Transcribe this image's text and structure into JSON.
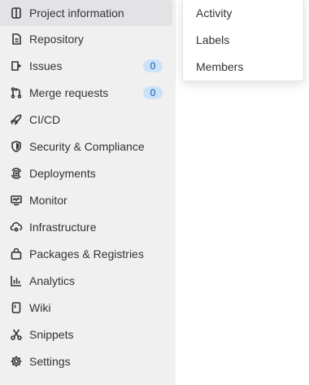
{
  "sidebar": {
    "items": [
      {
        "label": "Project information",
        "icon": "project-information-icon",
        "active": true
      },
      {
        "label": "Repository",
        "icon": "repository-icon"
      },
      {
        "label": "Issues",
        "icon": "issues-icon",
        "badge": "0"
      },
      {
        "label": "Merge requests",
        "icon": "merge-requests-icon",
        "badge": "0"
      },
      {
        "label": "CI/CD",
        "icon": "rocket-icon"
      },
      {
        "label": "Security & Compliance",
        "icon": "shield-icon"
      },
      {
        "label": "Deployments",
        "icon": "deployments-icon"
      },
      {
        "label": "Monitor",
        "icon": "monitor-icon"
      },
      {
        "label": "Infrastructure",
        "icon": "cloud-gear-icon"
      },
      {
        "label": "Packages & Registries",
        "icon": "package-icon"
      },
      {
        "label": "Analytics",
        "icon": "chart-icon"
      },
      {
        "label": "Wiki",
        "icon": "book-icon"
      },
      {
        "label": "Snippets",
        "icon": "scissors-icon"
      },
      {
        "label": "Settings",
        "icon": "gear-icon"
      }
    ]
  },
  "flyout": {
    "items": [
      {
        "label": "Activity"
      },
      {
        "label": "Labels"
      },
      {
        "label": "Members"
      }
    ]
  },
  "colors": {
    "sidebar_bg": "#f0f0f0",
    "active_bg": "#e3e3e6",
    "badge_bg": "#cbe2f9",
    "badge_text": "#0b5cad"
  }
}
